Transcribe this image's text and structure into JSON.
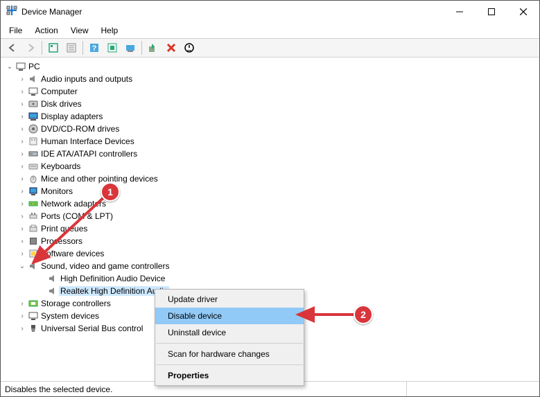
{
  "window": {
    "title": "Device Manager"
  },
  "menubar": [
    "File",
    "Action",
    "View",
    "Help"
  ],
  "tree": {
    "root": "PC",
    "nodes": [
      "Audio inputs and outputs",
      "Computer",
      "Disk drives",
      "Display adapters",
      "DVD/CD-ROM drives",
      "Human Interface Devices",
      "IDE ATA/ATAPI controllers",
      "Keyboards",
      "Mice and other pointing devices",
      "Monitors",
      "Network adapters",
      "Ports (COM & LPT)",
      "Print queues",
      "Processors",
      "Software devices"
    ],
    "expanded": {
      "label": "Sound, video and game controllers",
      "children": [
        "High Definition Audio Device",
        "Realtek High Definition Audio"
      ]
    },
    "after": [
      "Storage controllers",
      "System devices",
      "Universal Serial Bus control"
    ]
  },
  "context_menu": {
    "items": [
      "Update driver",
      "Disable device",
      "Uninstall device"
    ],
    "scan": "Scan for hardware changes",
    "properties": "Properties",
    "highlighted_index": 1
  },
  "statusbar": {
    "text": "Disables the selected device."
  },
  "annotations": {
    "one": "1",
    "two": "2"
  }
}
